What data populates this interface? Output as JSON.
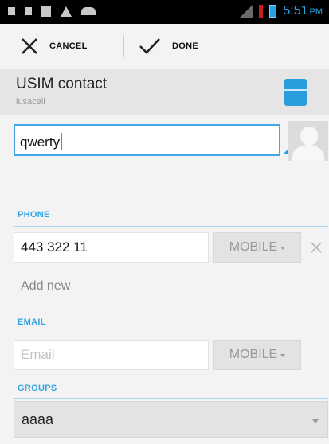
{
  "status_bar": {
    "time": "5:51",
    "ampm": "PM"
  },
  "action_bar": {
    "cancel_label": "CANCEL",
    "done_label": "DONE"
  },
  "account": {
    "name": "USIM contact",
    "subtitle": "iusacell"
  },
  "name_field": {
    "value": "qwerty"
  },
  "phone": {
    "header": "PHONE",
    "entries": [
      {
        "value": "443 322 11",
        "type": "MOBILE"
      }
    ],
    "add_new_label": "Add new"
  },
  "email": {
    "header": "EMAIL",
    "placeholder": "Email",
    "type": "MOBILE"
  },
  "groups": {
    "header": "GROUPS",
    "value": "aaaa"
  },
  "colors": {
    "accent": "#33a5e4",
    "status_bar": "#000000",
    "account_bg": "#e5e5e5"
  }
}
